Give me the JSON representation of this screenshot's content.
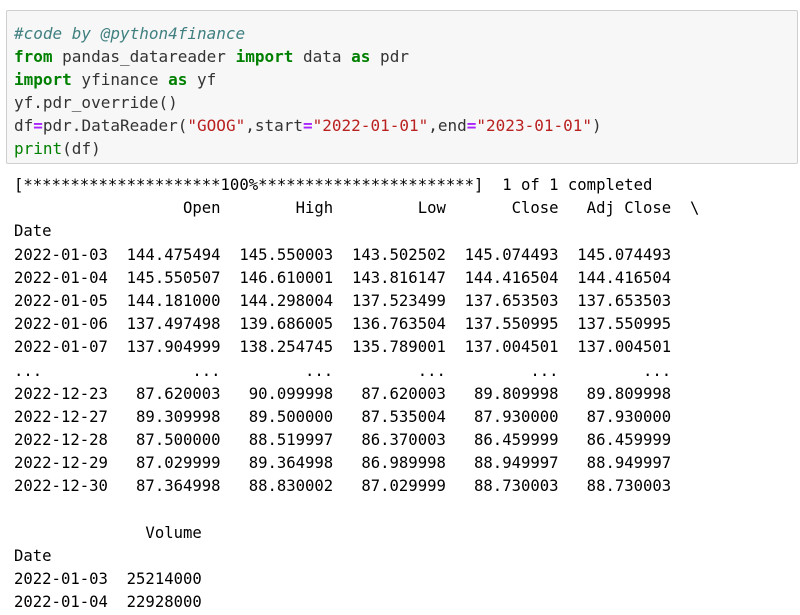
{
  "code_cell": {
    "lines": [
      {
        "segments": [
          {
            "t": "#code by @python4finance",
            "c": "c-comment"
          }
        ]
      },
      {
        "segments": [
          {
            "t": "from",
            "c": "c-kw"
          },
          {
            "t": " pandas_datareader ",
            "c": ""
          },
          {
            "t": "import",
            "c": "c-kw"
          },
          {
            "t": " data ",
            "c": ""
          },
          {
            "t": "as",
            "c": "c-kw"
          },
          {
            "t": " pdr",
            "c": ""
          }
        ]
      },
      {
        "segments": [
          {
            "t": "import",
            "c": "c-kw"
          },
          {
            "t": " yfinance ",
            "c": ""
          },
          {
            "t": "as",
            "c": "c-kw"
          },
          {
            "t": " yf",
            "c": ""
          }
        ]
      },
      {
        "segments": [
          {
            "t": "yf.pdr_override()",
            "c": ""
          }
        ]
      },
      {
        "segments": [
          {
            "t": "df",
            "c": ""
          },
          {
            "t": "=",
            "c": "c-op"
          },
          {
            "t": "pdr.DataReader(",
            "c": ""
          },
          {
            "t": "\"GOOG\"",
            "c": "c-str"
          },
          {
            "t": ",start",
            "c": ""
          },
          {
            "t": "=",
            "c": "c-op"
          },
          {
            "t": "\"2022-01-01\"",
            "c": "c-str"
          },
          {
            "t": ",end",
            "c": ""
          },
          {
            "t": "=",
            "c": "c-op"
          },
          {
            "t": "\"2023-01-01\"",
            "c": "c-str"
          },
          {
            "t": ")",
            "c": ""
          }
        ]
      },
      {
        "segments": [
          {
            "t": "print",
            "c": "c-fn"
          },
          {
            "t": "(df)",
            "c": ""
          }
        ]
      }
    ]
  },
  "output": {
    "lines": [
      "[*********************100%***********************]  1 of 1 completed",
      "                  Open        High         Low       Close   Adj Close  \\",
      "Date",
      "2022-01-03  144.475494  145.550003  143.502502  145.074493  145.074493",
      "2022-01-04  145.550507  146.610001  143.816147  144.416504  144.416504",
      "2022-01-05  144.181000  144.298004  137.523499  137.653503  137.653503",
      "2022-01-06  137.497498  139.686005  136.763504  137.550995  137.550995",
      "2022-01-07  137.904999  138.254745  135.789001  137.004501  137.004501",
      "...                ...         ...         ...         ...         ...",
      "2022-12-23   87.620003   90.099998   87.620003   89.809998   89.809998",
      "2022-12-27   89.309998   89.500000   87.535004   87.930000   87.930000",
      "2022-12-28   87.500000   88.519997   86.370003   86.459999   86.459999",
      "2022-12-29   87.029999   89.364998   86.989998   88.949997   88.949997",
      "2022-12-30   87.364998   88.830002   87.029999   88.730003   88.730003",
      "",
      "              Volume",
      "Date",
      "2022-01-03  25214000",
      "2022-01-04  22928000"
    ]
  }
}
